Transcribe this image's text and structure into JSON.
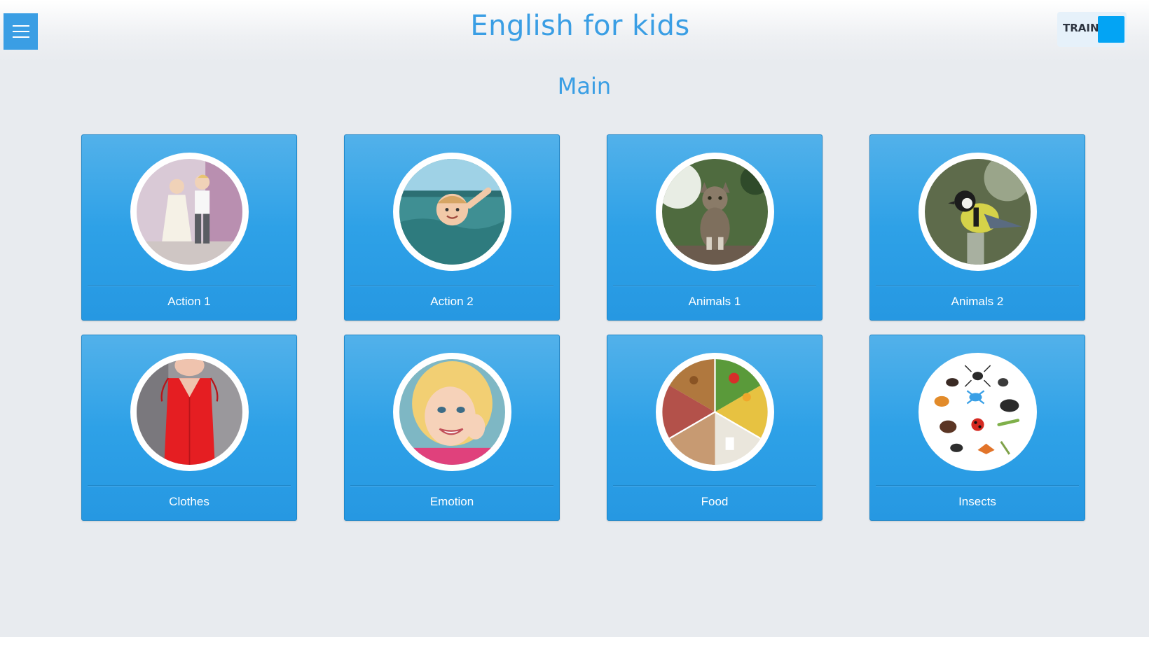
{
  "header": {
    "menu_icon": "hamburger-menu-icon",
    "title": "English for kids",
    "mode_toggle": {
      "label": "TRAIN",
      "knob_color": "#03a4f4"
    }
  },
  "main": {
    "page_title": "Main",
    "categories": [
      {
        "label": "Action 1",
        "image": "children-dancing"
      },
      {
        "label": "Action 2",
        "image": "child-swimming"
      },
      {
        "label": "Animals 1",
        "image": "cat"
      },
      {
        "label": "Animals 2",
        "image": "bird"
      },
      {
        "label": "Clothes",
        "image": "red-blouse"
      },
      {
        "label": "Emotion",
        "image": "smiling-girl"
      },
      {
        "label": "Food",
        "image": "food-plate"
      },
      {
        "label": "Insects",
        "image": "insects"
      }
    ]
  },
  "colors": {
    "accent": "#3a9ee4",
    "card_top": "#52b1ea",
    "card_bottom": "#2698e2",
    "background": "#e8ebef"
  }
}
